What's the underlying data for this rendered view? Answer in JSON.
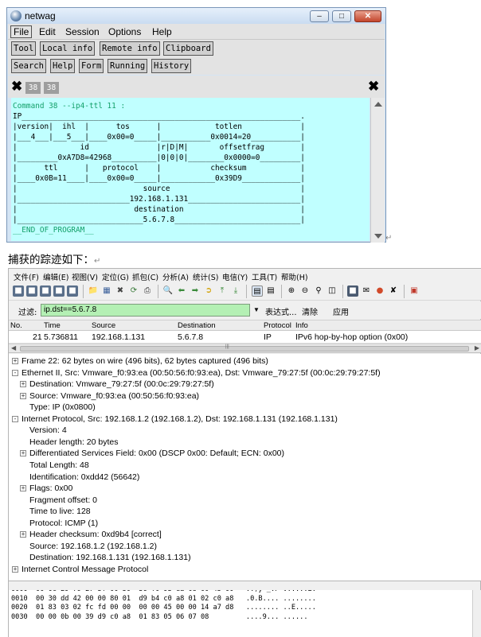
{
  "netwag": {
    "title": "netwag",
    "menus": [
      "File",
      "Edit",
      "Session",
      "Options",
      "Help"
    ],
    "toolbar_row1": [
      "Tool",
      "Local info",
      "Remote info",
      "Clipboard"
    ],
    "toolbar_row2": [
      "Search",
      "Help",
      "Form",
      "Running",
      "History"
    ],
    "tabs": [
      "38",
      "38"
    ],
    "command_lines": [
      "Command 38 --ip4-ttl 11 :",
      "IP______________________________________________________________.",
      "|version|  ihl  |      tos      |            totlen             |",
      "|___4___|___5___|____0x00=0_____|___________0x0014=20___________|",
      "|              id               |r|D|M|       offsetfrag        |",
      "|_________0xA7D8=42968__________|0|0|0|________0x0000=0_________|",
      "|      ttl      |   protocol    |           checksum            |",
      "|____0x0B=11____|____0x00=0_____|____________0x39D9_____________|",
      "|                            source                             |",
      "|_________________________192.168.1.131_________________________|",
      "|                          destination                          |",
      "|____________________________5.6.7.8____________________________|",
      "__END_OF_PROGRAM__"
    ]
  },
  "caption": "捕获的踪迹如下：",
  "wireshark": {
    "menus": [
      "文件(F)",
      "编辑(E)",
      "视图(V)",
      "定位(G)",
      "抓包(C)",
      "分析(A)",
      "统计(S)",
      "电信(Y)",
      "工具(T)",
      "帮助(H)"
    ],
    "filter": {
      "label": "过滤:",
      "value": "ip.dst==5.6.7.8",
      "expression": "表达式...",
      "clear": "清除",
      "apply": "应用"
    },
    "columns": [
      "No.",
      "Time",
      "Source",
      "Destination",
      "Protocol",
      "Info"
    ],
    "packet": {
      "no": "21",
      "time": "5.736811",
      "source": "192.168.1.131",
      "destination": "5.6.7.8",
      "protocol": "IP",
      "info": "IPv6 hop-by-hop option (0x00)"
    },
    "details": [
      {
        "indent": 0,
        "toggle": "+",
        "text": "Frame 22: 62 bytes on wire (496 bits), 62 bytes captured (496 bits)"
      },
      {
        "indent": 0,
        "toggle": "-",
        "text": "Ethernet II, Src: Vmware_f0:93:ea (00:50:56:f0:93:ea), Dst: Vmware_79:27:5f (00:0c:29:79:27:5f)"
      },
      {
        "indent": 1,
        "toggle": "+",
        "text": "Destination: Vmware_79:27:5f (00:0c:29:79:27:5f)"
      },
      {
        "indent": 1,
        "toggle": "+",
        "text": "Source: Vmware_f0:93:ea (00:50:56:f0:93:ea)"
      },
      {
        "indent": 1,
        "toggle": "",
        "text": "Type: IP (0x0800)"
      },
      {
        "indent": 0,
        "toggle": "-",
        "text": "Internet Protocol, Src: 192.168.1.2 (192.168.1.2), Dst: 192.168.1.131 (192.168.1.131)"
      },
      {
        "indent": 1,
        "toggle": "",
        "text": "Version: 4"
      },
      {
        "indent": 1,
        "toggle": "",
        "text": "Header length: 20 bytes"
      },
      {
        "indent": 1,
        "toggle": "+",
        "text": "Differentiated Services Field: 0x00 (DSCP 0x00: Default; ECN: 0x00)"
      },
      {
        "indent": 1,
        "toggle": "",
        "text": "Total Length: 48"
      },
      {
        "indent": 1,
        "toggle": "",
        "text": "Identification: 0xdd42 (56642)"
      },
      {
        "indent": 1,
        "toggle": "+",
        "text": "Flags: 0x00"
      },
      {
        "indent": 1,
        "toggle": "",
        "text": "Fragment offset: 0"
      },
      {
        "indent": 1,
        "toggle": "",
        "text": "Time to live: 128"
      },
      {
        "indent": 1,
        "toggle": "",
        "text": "Protocol: ICMP (1)"
      },
      {
        "indent": 1,
        "toggle": "+",
        "text": "Header checksum: 0xd9b4 [correct]"
      },
      {
        "indent": 1,
        "toggle": "",
        "text": "Source: 192.168.1.2 (192.168.1.2)"
      },
      {
        "indent": 1,
        "toggle": "",
        "text": "Destination: 192.168.1.131 (192.168.1.131)"
      },
      {
        "indent": 0,
        "toggle": "+",
        "text": "Internet Control Message Protocol"
      }
    ],
    "hex_lines": [
      "0000  00 0c 29 79 27 5f 00 50  56 f0 93 ea 08 00 45 00   ..)y'_.P V.....E.",
      "0010  00 30 dd 42 00 00 80 01  d9 b4 c0 a8 01 02 c0 a8   .0.B.... ........",
      "0020  01 83 03 02 fc fd 00 00  00 00 45 00 00 14 a7 d8   ........ ..E.....",
      "0030  00 00 0b 00 39 d9 c0 a8  01 83 05 06 07 08         ....9... ......"
    ]
  }
}
